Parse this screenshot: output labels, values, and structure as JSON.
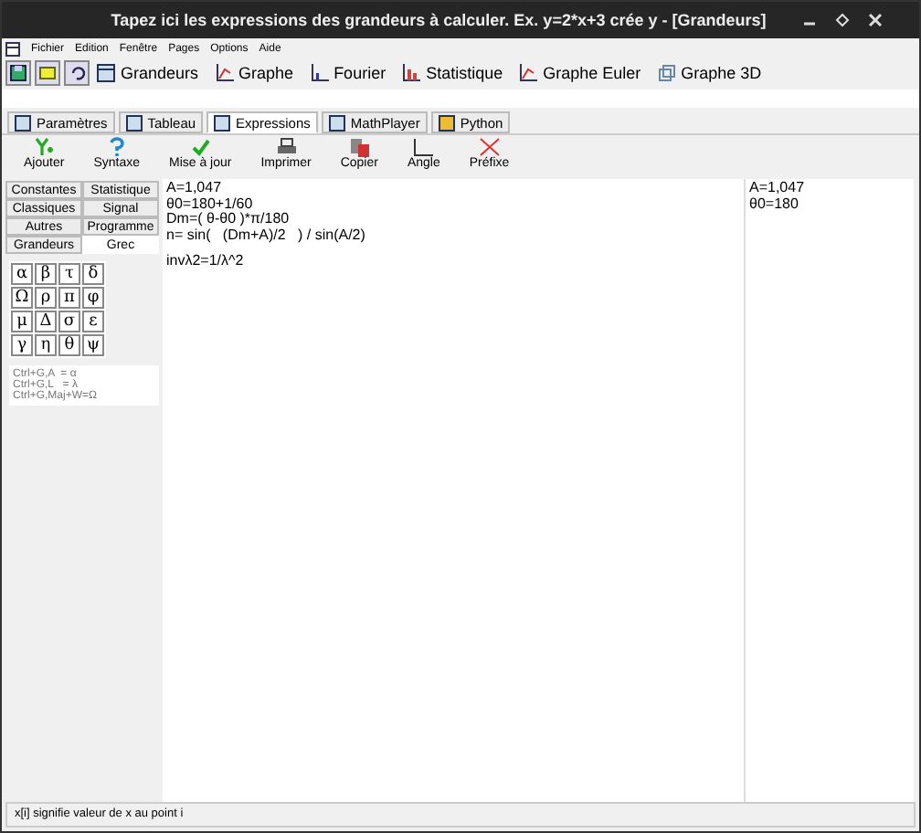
{
  "window": {
    "title": "Tapez ici les expressions des grandeurs à calculer. Ex. y=2*x+3 crée y - [Grandeurs]"
  },
  "menu": [
    "Fichier",
    "Edition",
    "Fenêtre",
    "Pages",
    "Options",
    "Aide"
  ],
  "toolbar": [
    {
      "label": "Grandeurs",
      "kind": "table"
    },
    {
      "label": "Graphe",
      "kind": "graph"
    },
    {
      "label": "Fourier",
      "kind": "fourier"
    },
    {
      "label": "Statistique",
      "kind": "stats"
    },
    {
      "label": "Graphe Euler",
      "kind": "graph"
    },
    {
      "label": "Graphe 3D",
      "kind": "cube"
    }
  ],
  "tabs": [
    {
      "label": "Paramètres",
      "selected": false
    },
    {
      "label": "Tableau",
      "selected": false
    },
    {
      "label": "Expressions",
      "selected": true
    },
    {
      "label": "MathPlayer",
      "selected": false
    },
    {
      "label": "Python",
      "selected": false
    }
  ],
  "actions": [
    {
      "label": "Ajouter",
      "kind": "add"
    },
    {
      "label": "Syntaxe",
      "kind": "help"
    },
    {
      "label": "Mise à jour",
      "kind": "check"
    },
    {
      "label": "Imprimer",
      "kind": "print"
    },
    {
      "label": "Copier",
      "kind": "copy"
    },
    {
      "label": "Angle",
      "kind": "angle"
    },
    {
      "label": "Préfixe",
      "kind": "prefix"
    }
  ],
  "side_tabs": [
    {
      "label": "Constantes",
      "selected": false
    },
    {
      "label": "Statistique",
      "selected": false
    },
    {
      "label": "Classiques",
      "selected": false
    },
    {
      "label": "Signal",
      "selected": false
    },
    {
      "label": "Autres",
      "selected": false
    },
    {
      "label": "Programme",
      "selected": false
    },
    {
      "label": "Grandeurs",
      "selected": false
    },
    {
      "label": "Grec",
      "selected": true
    }
  ],
  "greek_keys": [
    "α",
    "β",
    "τ",
    "δ",
    "Ω",
    "ρ",
    "π",
    "φ",
    "μ",
    "Δ",
    "σ",
    "ε",
    "γ",
    "η",
    "θ",
    "ψ"
  ],
  "shortcuts": [
    "Ctrl+G,A  = α",
    "Ctrl+G,L   = λ",
    "Ctrl+G,Maj+W=Ω"
  ],
  "editor_lines": [
    "A=1,047",
    "θ0=180+1/60",
    "Dm=( θ-θ0 )*π/180",
    "n= sin(   (Dm+A)/2   ) / sin(A/2)",
    "invλ2=1/λ^2"
  ],
  "results": [
    "A=1,047",
    "θ0=180"
  ],
  "status_bar": "x[i] signifie valeur de x au point i"
}
